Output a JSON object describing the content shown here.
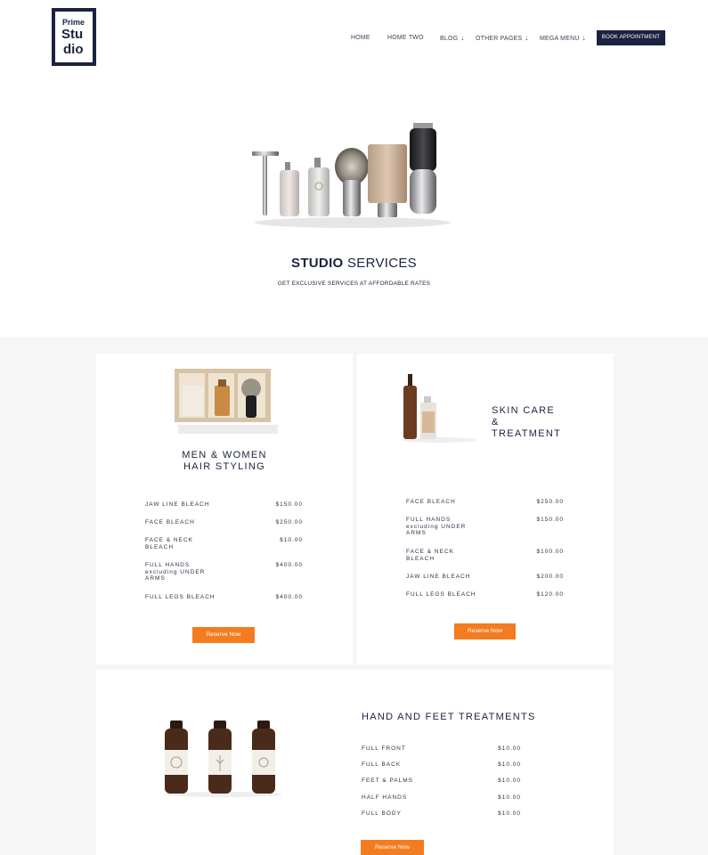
{
  "header": {
    "logo": {
      "line1": "Prime",
      "line2": "Stu",
      "line3": "dio"
    },
    "nav": [
      {
        "label": "HOME",
        "arrow": ""
      },
      {
        "label": "HOME TWO",
        "arrow": ""
      },
      {
        "label": "BLOG",
        "arrow": "↓"
      },
      {
        "label": "OTHER PAGES",
        "arrow": "↓"
      },
      {
        "label": "MEGA MENU",
        "arrow": "↓"
      }
    ],
    "cta": "BOOK APPOINTMENT"
  },
  "hero": {
    "title_bold": "STUDIO",
    "title_rest": "SERVICES",
    "subtitle": "GET EXCLUSIVE SERVICES AT AFFORDABLE RATES"
  },
  "cards": [
    {
      "title_line1": "MEN & WOMEN",
      "title_line2": "HAIR STYLING",
      "items": [
        {
          "name": "JAW LINE BLEACH",
          "price": "$150.00"
        },
        {
          "name": "FACE BLEACH",
          "price": "$250.00"
        },
        {
          "name": "FACE & NECK BLEACH",
          "price": "$10.00"
        },
        {
          "name": "FULL HANDS excluding UNDER ARMS",
          "price": "$400.00"
        },
        {
          "name": "FULL LEGS BLEACH",
          "price": "$400.00"
        }
      ],
      "button": "Reserve Now"
    },
    {
      "title_line1": "SKIN CARE",
      "title_line2": "& TREATMENT",
      "items": [
        {
          "name": "FACE BLEACH",
          "price": "$250.00"
        },
        {
          "name": "FULL HANDS excluding UNDER ARMS",
          "price": "$150.00"
        },
        {
          "name": "FACE & NECK BLEACH",
          "price": "$100.00"
        },
        {
          "name": "JAW LINE BLEACH",
          "price": "$200.00"
        },
        {
          "name": "FULL LEGS BLEACH",
          "price": "$120.00"
        }
      ],
      "button": "Reserve Now"
    },
    {
      "title_line1": "HAND AND FEET TREATMENTS",
      "items": [
        {
          "name": "FULL FRONT",
          "price": "$10.00"
        },
        {
          "name": "FULL BACK",
          "price": "$10.00"
        },
        {
          "name": "FEET & PALMS",
          "price": "$10.00"
        },
        {
          "name": "HALF HANDS",
          "price": "$10.00"
        },
        {
          "name": "FULL BODY",
          "price": "$10.00"
        }
      ],
      "button": "Reserve Now"
    }
  ],
  "colors": {
    "navy": "#1b2240",
    "accent": "#f47c20",
    "section_bg": "#f6f6f6"
  }
}
